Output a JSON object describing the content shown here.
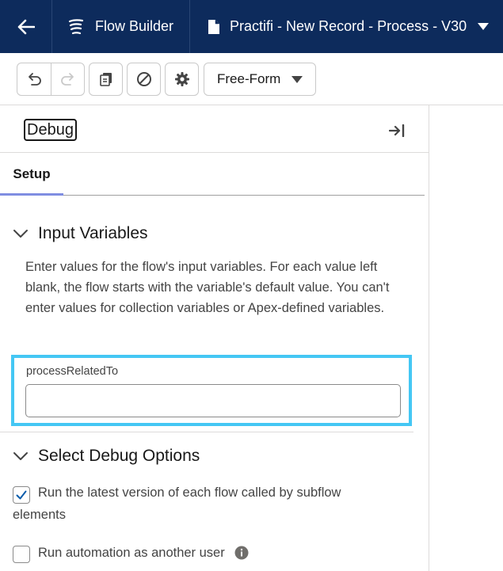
{
  "header": {
    "app_title": "Flow Builder",
    "doc_title": "Practifi - New Record - Process - V30"
  },
  "toolbar": {
    "canvas_mode": "Free-Form"
  },
  "panel": {
    "title": "Debug",
    "tabs": [
      {
        "label": "Setup",
        "active": true
      }
    ],
    "input_variables": {
      "heading": "Input Variables",
      "description": "Enter values for the flow's input variables. For each value left blank, the flow starts with the variable's default value. You can't enter values for collection variables or Apex-defined variables.",
      "fields": [
        {
          "label": "processRelatedTo",
          "value": ""
        }
      ]
    },
    "debug_options": {
      "heading": "Select Debug Options",
      "options": [
        {
          "label": "Run the latest version of each flow called by subflow elements",
          "checked": true
        },
        {
          "label": "Run automation as another user",
          "checked": false
        }
      ]
    }
  },
  "colors": {
    "header_bg": "#0d2b5c",
    "focus_ring": "#44c7f4",
    "tab_indicator": "#7f8de1",
    "check": "#0b5cab"
  },
  "icons": [
    "back-arrow-icon",
    "flow-builder-icon",
    "document-icon",
    "chevron-down-icon",
    "undo-icon",
    "redo-icon",
    "copy-icon",
    "stop-icon",
    "gear-icon",
    "collapse-panel-icon",
    "chevron-down-icon",
    "checkmark-icon",
    "info-icon"
  ]
}
